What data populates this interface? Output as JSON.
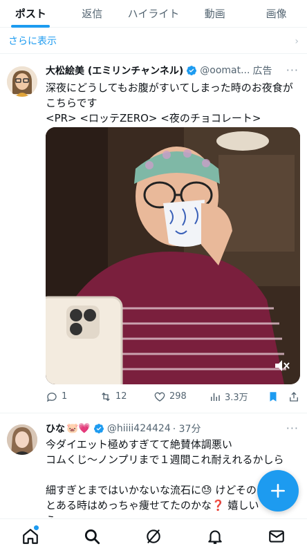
{
  "tabs": [
    {
      "label": "ポスト",
      "active": true
    },
    {
      "label": "返信"
    },
    {
      "label": "ハイライト"
    },
    {
      "label": "動画"
    },
    {
      "label": "画像"
    }
  ],
  "show_more": "さらに表示",
  "tweet1": {
    "name": "大松絵美 (エミリンチャンネル)",
    "handle": "@oomat...",
    "ad_label": "広告",
    "lines": [
      "深夜にどうしてもお腹がすいてしまった時のお夜食が",
      "こちらです",
      "<PR> <ロッテZERO> <夜のチョコレート>"
    ],
    "replies": "1",
    "retweets": "12",
    "likes": "298",
    "views": "3.3万"
  },
  "tweet2": {
    "name": "ひな",
    "emoji": "🐷💗",
    "handle": "@hiiii424424",
    "time": "· 37分",
    "lines": [
      "今ダイエット極めすぎてて絶賛体調悪い",
      "コムくじ〜ノンプリまで１週間これ耐えれるかしら",
      "",
      "細すぎとまではいかないな流石に😓 けどその",
      "とある時はめっちゃ痩せてたのかな❓ 嬉しい",
      "う"
    ]
  },
  "colors": {
    "accent": "#1d9bf0",
    "text": "#0f1419",
    "muted": "#536471"
  }
}
